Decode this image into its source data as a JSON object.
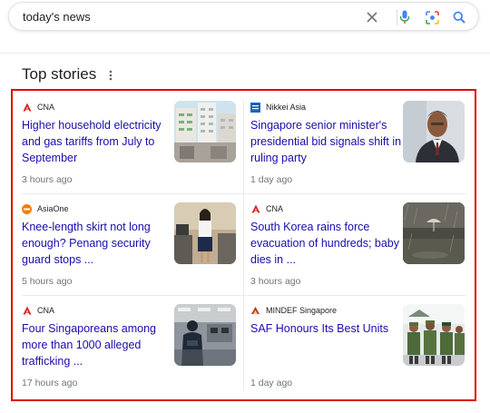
{
  "search": {
    "query": "today's news"
  },
  "section": {
    "title": "Top stories"
  },
  "stories": [
    {
      "source": "CNA",
      "headline": "Higher household electricity and gas tariffs from July to September",
      "time": "3 hours ago",
      "logo_icon": "cna-logo-icon",
      "thumb_icon": "apartment-buildings-photo"
    },
    {
      "source": "Nikkei Asia",
      "headline": "Singapore senior minister's presidential bid signals shift in ruling party",
      "time": "1 day ago",
      "logo_icon": "nikkei-asia-logo-icon",
      "thumb_icon": "minister-portrait-photo"
    },
    {
      "source": "AsiaOne",
      "headline": "Knee-length skirt not long enough? Penang security guard stops ...",
      "time": "5 hours ago",
      "logo_icon": "asiaone-logo-icon",
      "thumb_icon": "office-woman-photo"
    },
    {
      "source": "CNA",
      "headline": "South Korea rains force evacuation of hundreds; baby dies in ...",
      "time": "3 hours ago",
      "logo_icon": "cna-logo-icon",
      "thumb_icon": "rain-storm-photo"
    },
    {
      "source": "CNA",
      "headline": "Four Singaporeans among more than 1000 alleged trafficking ...",
      "time": "17 hours ago",
      "logo_icon": "cna-logo-icon",
      "thumb_icon": "raid-office-photo"
    },
    {
      "source": "MINDEF Singapore",
      "headline": "SAF Honours Its Best Units",
      "time": "1 day ago",
      "logo_icon": "mindef-logo-icon",
      "thumb_icon": "soldiers-parade-photo"
    }
  ],
  "colors": {
    "link": "#1a0dab",
    "meta": "#70757a",
    "highlight": "#e00000",
    "cna_red": "#e02020",
    "nikkei_blue": "#1565c0",
    "asiaone_orange": "#f57c00"
  }
}
